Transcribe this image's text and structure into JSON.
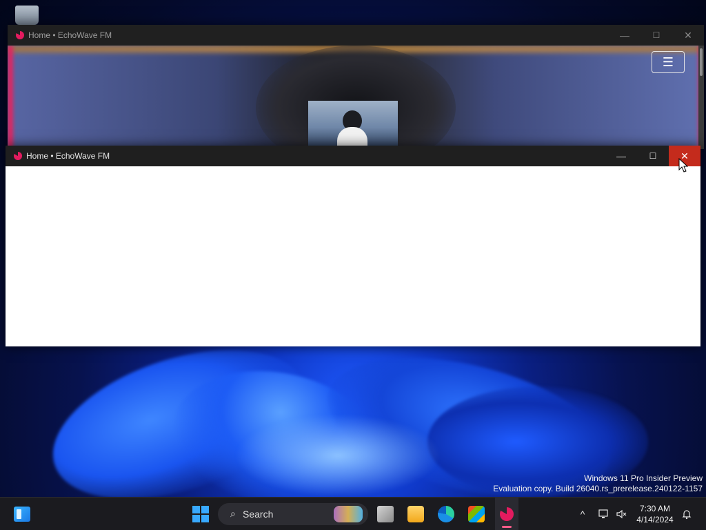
{
  "desktop": {
    "watermark": {
      "line1": "Windows 11 Pro Insider Preview",
      "line2": "Evaluation copy. Build 26040.rs_prerelease.240122-1157"
    }
  },
  "windows": {
    "back": {
      "title": "Home • EchoWave FM",
      "controls": {
        "minimize": "—",
        "maximize": "☐",
        "close": "✕"
      },
      "menu_icon": "☰"
    },
    "front": {
      "title": "Home • EchoWave FM",
      "controls": {
        "minimize": "—",
        "maximize": "☐",
        "close": "✕"
      }
    }
  },
  "taskbar": {
    "search_label": "Search",
    "search_icon": "⌕",
    "tray_chevron": "^",
    "clock_time": "7:30 AM",
    "clock_date": "4/14/2024",
    "icons": {
      "widgets": "widgets-icon",
      "start": "windows-start-icon",
      "taskview": "task-view-icon",
      "explorer": "file-explorer-icon",
      "edge": "edge-icon",
      "store": "microsoft-store-icon",
      "echowave": "echowave-app-icon",
      "network": "network-icon",
      "volume": "volume-muted-icon",
      "notifications": "notification-icon"
    }
  }
}
